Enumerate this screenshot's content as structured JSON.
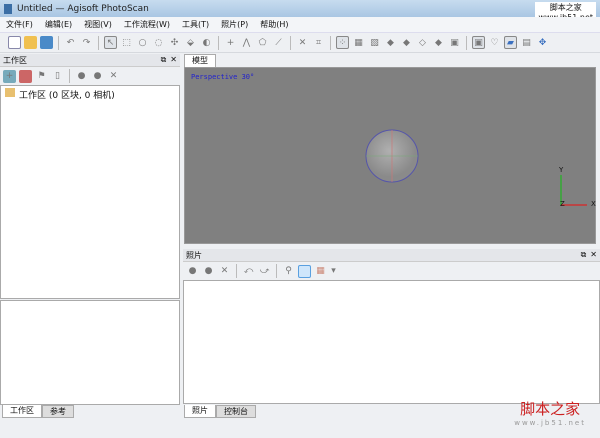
{
  "window": {
    "title": "Untitled — Agisoft PhotoScan"
  },
  "watermark": {
    "name": "脚本之家",
    "url": "www.jb51.net"
  },
  "menu": [
    "文件(F)",
    "编辑(E)",
    "视图(V)",
    "工作流程(W)",
    "工具(T)",
    "照片(P)",
    "帮助(H)"
  ],
  "workspace": {
    "title": "工作区",
    "tree_root": "工作区 (0 区块, 0 相机)",
    "tabs": [
      "工作区",
      "参考"
    ]
  },
  "model": {
    "tab": "模型",
    "projection": "Perspective 30°",
    "axes": {
      "x": "X",
      "y": "Y",
      "z": "Z"
    }
  },
  "photos": {
    "title": "照片",
    "tabs": [
      "照片",
      "控制台"
    ]
  },
  "colors": {
    "viewport_bg": "#808080",
    "projection_text": "#2222cc"
  }
}
